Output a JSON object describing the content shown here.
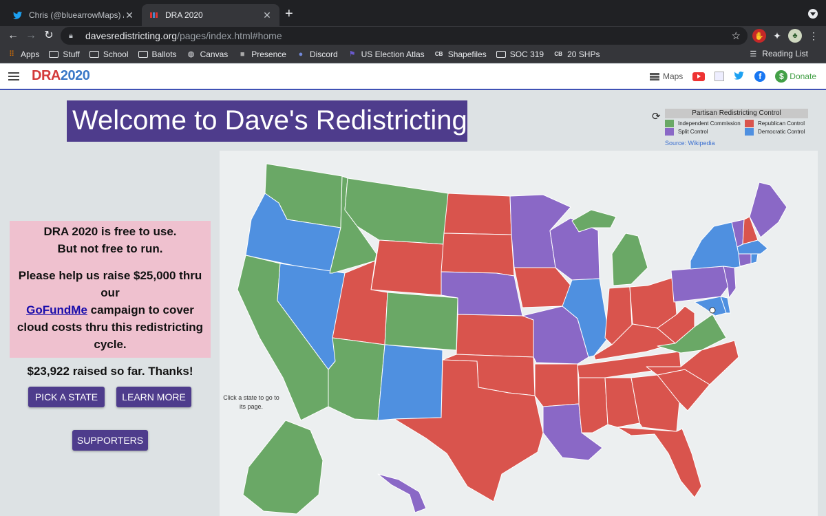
{
  "browser": {
    "tabs": [
      {
        "title": "Chris (@bluearrowMaps) / Twitt",
        "active": false
      },
      {
        "title": "DRA 2020",
        "active": true
      }
    ],
    "url_host": "davesredistricting.org",
    "url_path": "/pages/index.html#home",
    "bookmarks": [
      {
        "label": "Apps",
        "icon": "apps-grid-icon"
      },
      {
        "label": "Stuff",
        "icon": "folder-icon"
      },
      {
        "label": "School",
        "icon": "folder-icon"
      },
      {
        "label": "Ballots",
        "icon": "folder-icon"
      },
      {
        "label": "Canvas",
        "icon": "globe-icon"
      },
      {
        "label": "Presence",
        "icon": "presence-icon"
      },
      {
        "label": "Discord",
        "icon": "discord-icon"
      },
      {
        "label": "US Election Atlas",
        "icon": "flag-icon"
      },
      {
        "label": "Shapefiles",
        "icon": "cb-icon"
      },
      {
        "label": "SOC 319",
        "icon": "folder-icon"
      },
      {
        "label": "20 SHPs",
        "icon": "cb-icon"
      }
    ],
    "reading_list": "Reading List"
  },
  "site": {
    "logo_part1": "DRA",
    "logo_part2": "2020",
    "nav": {
      "maps": "Maps",
      "donate": "Donate"
    },
    "welcome": "Welcome to Dave's Redistricting",
    "fund": {
      "line1": "DRA 2020 is free to use.",
      "line2": "But not free to run.",
      "appeal_before": "Please help us raise $25,000 thru our",
      "link": "GoFundMe",
      "appeal_after": "campaign to cover cloud costs thru this redistricting cycle.",
      "raised": "$23,922 raised so far. Thanks!"
    },
    "buttons": {
      "pick": "PICK A STATE",
      "learn": "LEARN MORE",
      "supporters": "SUPPORTERS"
    },
    "map_hint": "Click a state to go to its page.",
    "legend": {
      "title": "Partisan Redistricting Control",
      "items": [
        {
          "label": "Independent Commission",
          "color": "#6aa866"
        },
        {
          "label": "Republican Control",
          "color": "#d9544d"
        },
        {
          "label": "Split Control",
          "color": "#8a68c6"
        },
        {
          "label": "Democratic Control",
          "color": "#4f90e0"
        }
      ],
      "source": "Source: Wikipedia"
    }
  }
}
